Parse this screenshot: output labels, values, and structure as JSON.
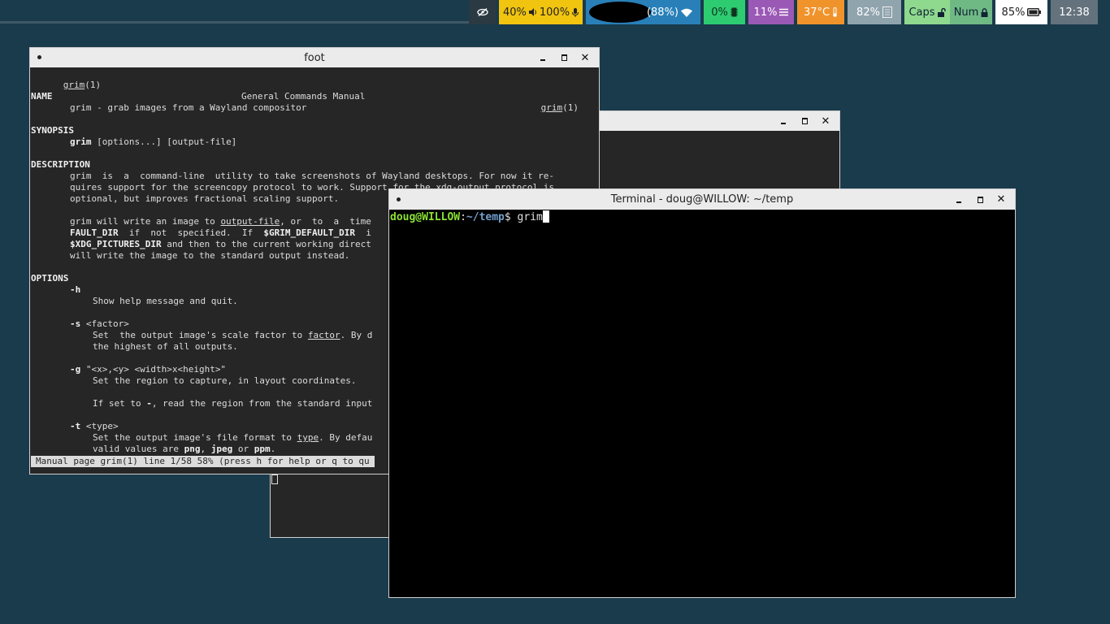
{
  "topbar": {
    "modules": {
      "audio_volume": "40%",
      "mic_volume": "100%",
      "wifi_strength": "(88%)",
      "cpu": "0%",
      "memory": "11%",
      "temperature": "37°C",
      "backlight": "82%",
      "caps": "Caps",
      "num": "Num",
      "battery": "85%",
      "clock": "12:38"
    },
    "icons": [
      "eye-off-icon",
      "speaker-icon",
      "microphone-icon",
      "wifi-icon",
      "cpu-icon",
      "memory-icon",
      "thermometer-icon",
      "backlight-icon",
      "unlock-icon",
      "lock-icon",
      "battery-icon"
    ]
  },
  "windows": {
    "foot": {
      "title": "foot",
      "header": {
        "left_name": "grim",
        "left_sec": "(1)",
        "center": "General Commands Manual",
        "right_name": "grim",
        "right_sec": "(1)"
      },
      "name_heading": "NAME",
      "name_text": "grim - grab images from a Wayland compositor",
      "synopsis_heading": "SYNOPSIS",
      "synopsis_cmd": "grim",
      "synopsis_args": " [options...] [output-file]",
      "description_heading": "DESCRIPTION",
      "desc_line1": "grim  is  a  command-line  utility to take screenshots of Wayland desktops. For now it re-",
      "desc_line2": "quires support for the screencopy protocol to work. Support for the xdg-output protocol is",
      "desc_line3": "optional, but improves fractional scaling support.",
      "desc2_a": "grim will write an image to ",
      "desc2_outfile": "output-file",
      "desc2_b": ", or  to  a  time",
      "desc3_a": "FAULT_DIR",
      "desc3_b": "  if  not  specified.  If  ",
      "desc3_c": "$GRIM_DEFAULT_DIR",
      "desc3_d": "  i",
      "desc4_a": "$XDG_PICTURES_DIR",
      "desc4_b": " and then to the current working direct",
      "desc5": "will write the image to the standard output instead.",
      "options_heading": "OPTIONS",
      "opt_h": "-h",
      "opt_h_desc": "Show help message and quit.",
      "opt_s": "-s",
      "opt_s_arg": " <factor>",
      "opt_s_desc_a": "Set  the output image's scale factor to ",
      "opt_s_factor": "factor",
      "opt_s_desc_b": ". By d",
      "opt_s_desc2": "the highest of all outputs.",
      "opt_g": "-g",
      "opt_g_arg": " \"<x>,<y> <width>x<height>\"",
      "opt_g_desc": "Set the region to capture, in layout coordinates.",
      "opt_g_desc2_a": "If set to ",
      "opt_g_dash": "-",
      "opt_g_desc2_b": ", read the region from the standard input",
      "opt_t": "-t",
      "opt_t_arg": " <type>",
      "opt_t_desc_a": "Set the output image's file format to ",
      "opt_t_type": "type",
      "opt_t_desc_b": ". By defau",
      "opt_t_desc2_a": "valid values are ",
      "opt_t_png": "png",
      "opt_t_sep1": ", ",
      "opt_t_jpeg": "jpeg",
      "opt_t_sep2": " or ",
      "opt_t_ppm": "ppm",
      "opt_t_end": ".",
      "status": "Manual page grim(1) line 1/58 58% (press h for help or q to qu"
    },
    "terminal": {
      "title": "Terminal - doug@WILLOW: ~/temp",
      "prompt_user": "doug@WILLOW",
      "prompt_colon": ":",
      "prompt_path": "~/temp",
      "prompt_sigil": "$ ",
      "command": "grim"
    }
  }
}
